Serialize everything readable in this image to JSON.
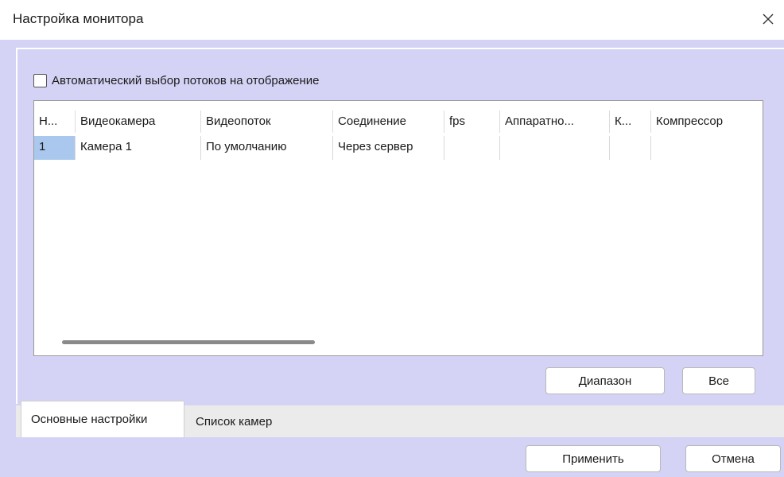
{
  "window": {
    "title": "Настройка монитора",
    "close_glyph": "✕"
  },
  "options": {
    "auto_select_label": "Автоматический выбор потоков на отображение",
    "auto_select_checked": false
  },
  "table": {
    "columns": [
      "Н...",
      "Видеокамера",
      "Видеопоток",
      "Соединение",
      "fps",
      "Аппаратно...",
      "К...",
      "Компрессор"
    ],
    "rows": [
      [
        "1",
        "Камера 1",
        "По умолчанию",
        "Через сервер",
        "",
        "",
        "",
        ""
      ]
    ]
  },
  "buttons": {
    "range": "Диапазон",
    "all": "Все",
    "apply": "Применить",
    "cancel": "Отмена"
  },
  "tabs": [
    {
      "label": "Основные настройки",
      "active": true
    },
    {
      "label": "Список камер",
      "active": false
    }
  ],
  "colors": {
    "panel_bg": "#d4d3f5",
    "selection": "#aac8ee"
  }
}
